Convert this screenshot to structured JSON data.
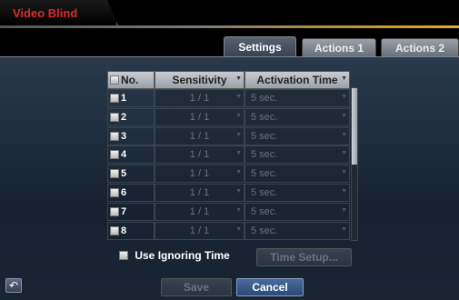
{
  "window": {
    "title": "Video Blind"
  },
  "tabs": [
    {
      "label": "Settings"
    },
    {
      "label": "Actions 1"
    },
    {
      "label": "Actions 2"
    }
  ],
  "table": {
    "headers": {
      "no": "No.",
      "sensitivity": "Sensitivity",
      "activation": "Activation Time"
    },
    "rows": [
      {
        "no": "1",
        "sensitivity": "1 / 1",
        "activation": "5 sec."
      },
      {
        "no": "2",
        "sensitivity": "1 / 1",
        "activation": "5 sec."
      },
      {
        "no": "3",
        "sensitivity": "1 / 1",
        "activation": "5 sec."
      },
      {
        "no": "4",
        "sensitivity": "1 / 1",
        "activation": "5 sec."
      },
      {
        "no": "5",
        "sensitivity": "1 / 1",
        "activation": "5 sec."
      },
      {
        "no": "6",
        "sensitivity": "1 / 1",
        "activation": "5 sec."
      },
      {
        "no": "7",
        "sensitivity": "1 / 1",
        "activation": "5 sec."
      },
      {
        "no": "8",
        "sensitivity": "1 / 1",
        "activation": "5 sec."
      }
    ]
  },
  "options": {
    "use_ignoring_time": "Use Ignoring Time",
    "time_setup": "Time Setup..."
  },
  "footer": {
    "save": "Save",
    "cancel": "Cancel",
    "back_icon": "back-arrow-icon"
  },
  "colors": {
    "title_red": "#e02828",
    "accent_gold": "#d8a020",
    "primary_button": "#2a4a7a"
  }
}
